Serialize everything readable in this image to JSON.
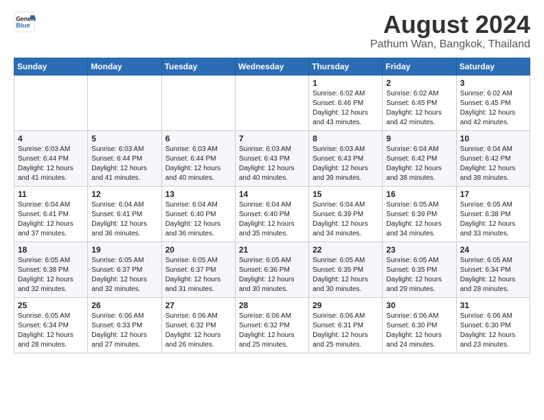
{
  "header": {
    "logo_line1": "General",
    "logo_line2": "Blue",
    "month": "August 2024",
    "location": "Pathum Wan, Bangkok, Thailand"
  },
  "days_of_week": [
    "Sunday",
    "Monday",
    "Tuesday",
    "Wednesday",
    "Thursday",
    "Friday",
    "Saturday"
  ],
  "weeks": [
    [
      {
        "day": "",
        "info": ""
      },
      {
        "day": "",
        "info": ""
      },
      {
        "day": "",
        "info": ""
      },
      {
        "day": "",
        "info": ""
      },
      {
        "day": "1",
        "info": "Sunrise: 6:02 AM\nSunset: 6:46 PM\nDaylight: 12 hours\nand 43 minutes."
      },
      {
        "day": "2",
        "info": "Sunrise: 6:02 AM\nSunset: 6:45 PM\nDaylight: 12 hours\nand 42 minutes."
      },
      {
        "day": "3",
        "info": "Sunrise: 6:02 AM\nSunset: 6:45 PM\nDaylight: 12 hours\nand 42 minutes."
      }
    ],
    [
      {
        "day": "4",
        "info": "Sunrise: 6:03 AM\nSunset: 6:44 PM\nDaylight: 12 hours\nand 41 minutes."
      },
      {
        "day": "5",
        "info": "Sunrise: 6:03 AM\nSunset: 6:44 PM\nDaylight: 12 hours\nand 41 minutes."
      },
      {
        "day": "6",
        "info": "Sunrise: 6:03 AM\nSunset: 6:44 PM\nDaylight: 12 hours\nand 40 minutes."
      },
      {
        "day": "7",
        "info": "Sunrise: 6:03 AM\nSunset: 6:43 PM\nDaylight: 12 hours\nand 40 minutes."
      },
      {
        "day": "8",
        "info": "Sunrise: 6:03 AM\nSunset: 6:43 PM\nDaylight: 12 hours\nand 39 minutes."
      },
      {
        "day": "9",
        "info": "Sunrise: 6:04 AM\nSunset: 6:42 PM\nDaylight: 12 hours\nand 38 minutes."
      },
      {
        "day": "10",
        "info": "Sunrise: 6:04 AM\nSunset: 6:42 PM\nDaylight: 12 hours\nand 38 minutes."
      }
    ],
    [
      {
        "day": "11",
        "info": "Sunrise: 6:04 AM\nSunset: 6:41 PM\nDaylight: 12 hours\nand 37 minutes."
      },
      {
        "day": "12",
        "info": "Sunrise: 6:04 AM\nSunset: 6:41 PM\nDaylight: 12 hours\nand 36 minutes."
      },
      {
        "day": "13",
        "info": "Sunrise: 6:04 AM\nSunset: 6:40 PM\nDaylight: 12 hours\nand 36 minutes."
      },
      {
        "day": "14",
        "info": "Sunrise: 6:04 AM\nSunset: 6:40 PM\nDaylight: 12 hours\nand 35 minutes."
      },
      {
        "day": "15",
        "info": "Sunrise: 6:04 AM\nSunset: 6:39 PM\nDaylight: 12 hours\nand 34 minutes."
      },
      {
        "day": "16",
        "info": "Sunrise: 6:05 AM\nSunset: 6:39 PM\nDaylight: 12 hours\nand 34 minutes."
      },
      {
        "day": "17",
        "info": "Sunrise: 6:05 AM\nSunset: 6:38 PM\nDaylight: 12 hours\nand 33 minutes."
      }
    ],
    [
      {
        "day": "18",
        "info": "Sunrise: 6:05 AM\nSunset: 6:38 PM\nDaylight: 12 hours\nand 32 minutes."
      },
      {
        "day": "19",
        "info": "Sunrise: 6:05 AM\nSunset: 6:37 PM\nDaylight: 12 hours\nand 32 minutes."
      },
      {
        "day": "20",
        "info": "Sunrise: 6:05 AM\nSunset: 6:37 PM\nDaylight: 12 hours\nand 31 minutes."
      },
      {
        "day": "21",
        "info": "Sunrise: 6:05 AM\nSunset: 6:36 PM\nDaylight: 12 hours\nand 30 minutes."
      },
      {
        "day": "22",
        "info": "Sunrise: 6:05 AM\nSunset: 6:35 PM\nDaylight: 12 hours\nand 30 minutes."
      },
      {
        "day": "23",
        "info": "Sunrise: 6:05 AM\nSunset: 6:35 PM\nDaylight: 12 hours\nand 29 minutes."
      },
      {
        "day": "24",
        "info": "Sunrise: 6:05 AM\nSunset: 6:34 PM\nDaylight: 12 hours\nand 28 minutes."
      }
    ],
    [
      {
        "day": "25",
        "info": "Sunrise: 6:05 AM\nSunset: 6:34 PM\nDaylight: 12 hours\nand 28 minutes."
      },
      {
        "day": "26",
        "info": "Sunrise: 6:06 AM\nSunset: 6:33 PM\nDaylight: 12 hours\nand 27 minutes."
      },
      {
        "day": "27",
        "info": "Sunrise: 6:06 AM\nSunset: 6:32 PM\nDaylight: 12 hours\nand 26 minutes."
      },
      {
        "day": "28",
        "info": "Sunrise: 6:06 AM\nSunset: 6:32 PM\nDaylight: 12 hours\nand 25 minutes."
      },
      {
        "day": "29",
        "info": "Sunrise: 6:06 AM\nSunset: 6:31 PM\nDaylight: 12 hours\nand 25 minutes."
      },
      {
        "day": "30",
        "info": "Sunrise: 6:06 AM\nSunset: 6:30 PM\nDaylight: 12 hours\nand 24 minutes."
      },
      {
        "day": "31",
        "info": "Sunrise: 6:06 AM\nSunset: 6:30 PM\nDaylight: 12 hours\nand 23 minutes."
      }
    ]
  ]
}
